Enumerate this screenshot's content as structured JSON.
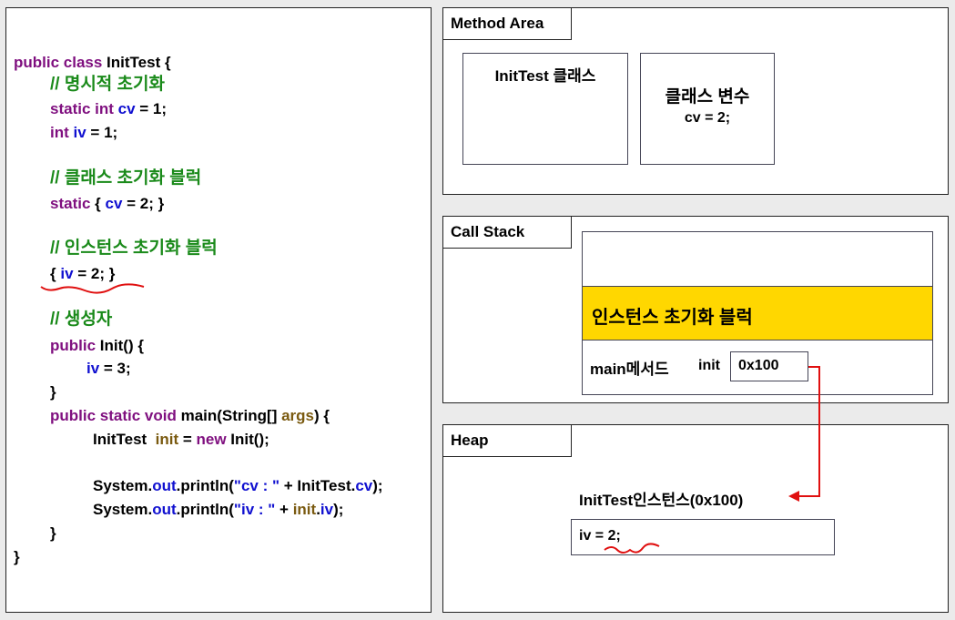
{
  "code": {
    "l1_kw": "public class",
    "l1_name": " InitTest {",
    "c1": "// 명시적 초기화",
    "l3_kw": "static int",
    "l3_var": "cv",
    "l3_rest": " = 1;",
    "l4_kw": "int",
    "l4_var": "iv",
    "l4_rest": " = 1;",
    "c2": "// 클래스 초기화 블럭",
    "l6_kw": "static",
    "l6_pre": " { ",
    "l6_var": "cv",
    "l6_rest": " = 2; }",
    "c3": "// 인스턴스 초기화 블럭",
    "l8_pre": "{ ",
    "l8_var": "iv",
    "l8_rest": " = 2; }",
    "c4": "// 생성자",
    "l10_kw": "public",
    "l10_rest": " Init() {",
    "l11_var": "iv",
    "l11_rest": " = 3;",
    "l12": "}",
    "l13_kw": "public static void",
    "l13_mid": " main(String[] ",
    "l13_arg": "args",
    "l13_rest": ") {",
    "l14_pre": "InitTest  ",
    "l14_nm": "init",
    "l14_mid": " = ",
    "l14_kw": "new",
    "l14_rest": " Init();",
    "l15_pre": "System.",
    "l15_out": "out",
    "l15_mid": ".println(",
    "l15_str": "\"cv : \"",
    "l15_plus": " + InitTest.",
    "l15_var": "cv",
    "l15_end": ");",
    "l16_pre": "System.",
    "l16_out": "out",
    "l16_mid": ".println(",
    "l16_str": "\"iv : \"",
    "l16_plus": " + ",
    "l16_nm": "init",
    "l16_dot": ".",
    "l16_var": "iv",
    "l16_end": ");",
    "l17": "}",
    "l18": "}"
  },
  "method_area": {
    "label": "Method Area",
    "class_box": "InitTest 클래스",
    "var_box_title": "클래스 변수",
    "var_box_value": "cv = 2;"
  },
  "call_stack": {
    "label": "Call Stack",
    "frame_top": "",
    "highlight": "인스턴스 초기화 블럭",
    "main_label": "main메서드",
    "init_label": "init",
    "init_value": "0x100"
  },
  "heap": {
    "label": "Heap",
    "instance_title": "InitTest인스턴스(0x100)",
    "instance_field": "iv = 2;"
  },
  "colors": {
    "highlight": "#ffd700",
    "arrow": "#e01010",
    "keyword": "#7f0f7f",
    "variable": "#1010d0",
    "comment": "#1a8a1a"
  }
}
